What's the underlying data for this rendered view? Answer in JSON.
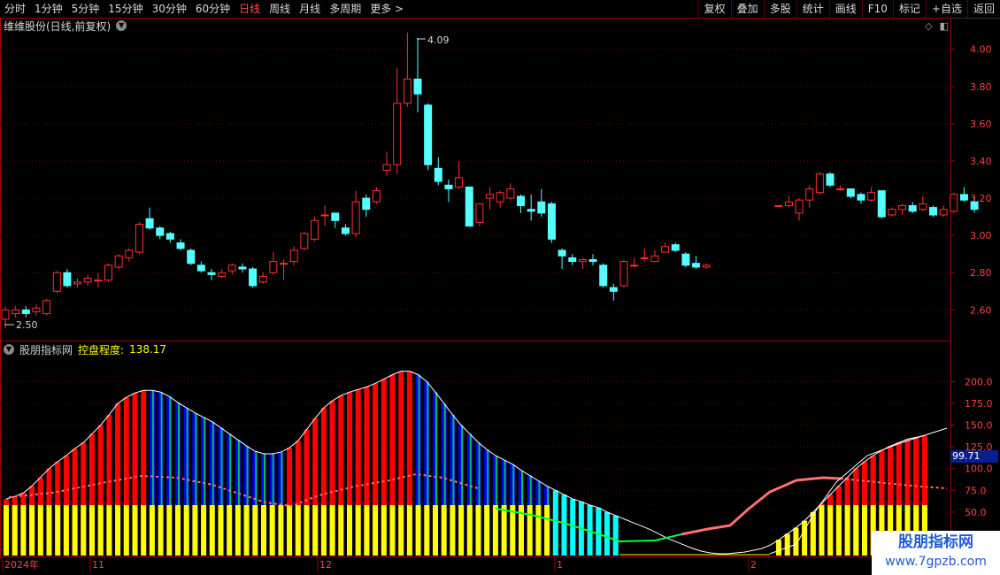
{
  "toolbar": {
    "periods": [
      "分时",
      "1分钟",
      "5分钟",
      "15分钟",
      "30分钟",
      "60分钟",
      "日线",
      "周线",
      "月线",
      "多周期",
      "更多 >"
    ],
    "active_period": "日线",
    "buttons": [
      "复权",
      "叠加",
      "多股",
      "统计",
      "画线",
      "F10",
      "标记",
      "+自选",
      "返回"
    ]
  },
  "chart_header": {
    "stock_title": "维维股份(日线,前复权)",
    "high_label": "4.09",
    "low_label": "2.50"
  },
  "indicator_header": {
    "name": "股朋指标网",
    "label": "控盘程度:",
    "value": "138.17"
  },
  "indicator_value_box": "99.71",
  "x_axis_labels": [
    "2024年",
    "11",
    "12",
    "1",
    "2"
  ],
  "watermark": {
    "line1": "股朋指标网",
    "line2": "www.7gpzb.com"
  },
  "colors": {
    "up": "#ff3030",
    "down": "#54ffff",
    "bar_red": "#ff0000",
    "bar_blue": "#0000ff",
    "bar_yellow": "#ffff00",
    "bar_cyan": "#00ffff",
    "grid": "#6a0000"
  },
  "chart_data": [
    {
      "type": "candlestick",
      "title": "维维股份(日线,前复权)",
      "y_ticks": [
        2.6,
        2.8,
        3.0,
        3.2,
        3.4,
        3.6,
        3.8,
        4.0
      ],
      "ylim": [
        2.44,
        4.16
      ],
      "candles": [
        [
          2.55,
          2.6,
          2.62,
          2.5
        ],
        [
          2.58,
          2.6,
          2.62,
          2.56
        ],
        [
          2.6,
          2.58,
          2.62,
          2.56
        ],
        [
          2.59,
          2.61,
          2.63,
          2.57
        ],
        [
          2.58,
          2.65,
          2.66,
          2.57
        ],
        [
          2.7,
          2.8,
          2.81,
          2.69
        ],
        [
          2.8,
          2.73,
          2.82,
          2.72
        ],
        [
          2.74,
          2.75,
          2.77,
          2.72
        ],
        [
          2.75,
          2.77,
          2.79,
          2.73
        ],
        [
          2.76,
          2.76,
          2.8,
          2.72
        ],
        [
          2.76,
          2.84,
          2.85,
          2.75
        ],
        [
          2.83,
          2.89,
          2.9,
          2.82
        ],
        [
          2.88,
          2.92,
          2.93,
          2.86
        ],
        [
          2.91,
          3.06,
          3.07,
          2.9
        ],
        [
          3.09,
          3.04,
          3.15,
          3.03
        ],
        [
          3.04,
          3.0,
          3.05,
          2.98
        ],
        [
          3.01,
          2.98,
          3.02,
          2.96
        ],
        [
          2.96,
          2.93,
          2.98,
          2.92
        ],
        [
          2.92,
          2.85,
          2.93,
          2.84
        ],
        [
          2.84,
          2.81,
          2.86,
          2.8
        ],
        [
          2.8,
          2.79,
          2.82,
          2.76
        ],
        [
          2.78,
          2.8,
          2.82,
          2.77
        ],
        [
          2.81,
          2.84,
          2.85,
          2.79
        ],
        [
          2.83,
          2.82,
          2.85,
          2.8
        ],
        [
          2.82,
          2.73,
          2.83,
          2.72
        ],
        [
          2.75,
          2.78,
          2.8,
          2.74
        ],
        [
          2.8,
          2.86,
          2.91,
          2.79
        ],
        [
          2.85,
          2.85,
          2.87,
          2.76
        ],
        [
          2.86,
          2.92,
          2.94,
          2.84
        ],
        [
          2.93,
          3.01,
          3.02,
          2.92
        ],
        [
          2.98,
          3.08,
          3.1,
          2.97
        ],
        [
          3.11,
          3.11,
          3.16,
          3.05
        ],
        [
          3.12,
          3.08,
          3.11,
          3.04
        ],
        [
          3.04,
          3.01,
          3.06,
          3.0
        ],
        [
          3.01,
          3.18,
          3.24,
          2.99
        ],
        [
          3.2,
          3.14,
          3.22,
          3.1
        ],
        [
          3.18,
          3.24,
          3.26,
          3.17
        ],
        [
          3.35,
          3.38,
          3.45,
          3.32
        ],
        [
          3.38,
          3.71,
          3.9,
          3.33
        ],
        [
          3.71,
          3.84,
          4.09,
          3.69
        ],
        [
          3.84,
          3.76,
          4.06,
          3.66
        ],
        [
          3.7,
          3.38,
          3.71,
          3.35
        ],
        [
          3.36,
          3.29,
          3.42,
          3.27
        ],
        [
          3.27,
          3.25,
          3.3,
          3.18
        ],
        [
          3.26,
          3.31,
          3.4,
          3.25
        ],
        [
          3.26,
          3.05,
          3.26,
          3.05
        ],
        [
          3.07,
          3.17,
          3.17,
          3.05
        ],
        [
          3.2,
          3.22,
          3.26,
          3.14
        ],
        [
          3.18,
          3.23,
          3.24,
          3.15
        ],
        [
          3.2,
          3.25,
          3.28,
          3.19
        ],
        [
          3.21,
          3.16,
          3.22,
          3.12
        ],
        [
          3.14,
          3.13,
          3.22,
          3.08
        ],
        [
          3.18,
          3.12,
          3.25,
          3.1
        ],
        [
          3.17,
          2.98,
          3.18,
          2.96
        ],
        [
          2.92,
          2.89,
          2.93,
          2.82
        ],
        [
          2.88,
          2.86,
          2.9,
          2.84
        ],
        [
          2.86,
          2.87,
          2.88,
          2.82
        ],
        [
          2.87,
          2.86,
          2.9,
          2.84
        ],
        [
          2.84,
          2.73,
          2.85,
          2.72
        ],
        [
          2.72,
          2.7,
          2.74,
          2.65
        ],
        [
          2.73,
          2.86,
          2.87,
          2.72
        ],
        [
          2.84,
          2.84,
          2.88,
          2.83
        ],
        [
          2.88,
          2.88,
          2.93,
          2.86
        ],
        [
          2.86,
          2.89,
          2.92,
          2.86
        ],
        [
          2.91,
          2.94,
          2.96,
          2.91
        ],
        [
          2.95,
          2.92,
          2.96,
          2.91
        ],
        [
          2.9,
          2.84,
          2.91,
          2.83
        ],
        [
          2.85,
          2.83,
          2.89,
          2.82
        ],
        [
          2.83,
          2.84,
          2.85,
          2.82
        ],
        null,
        null,
        null,
        null,
        null,
        null,
        [
          3.16,
          3.16,
          3.16,
          3.16
        ],
        [
          3.16,
          3.18,
          3.21,
          3.15
        ],
        [
          3.12,
          3.19,
          3.2,
          3.08
        ],
        [
          3.19,
          3.25,
          3.27,
          3.15
        ],
        [
          3.23,
          3.33,
          3.34,
          3.22
        ],
        [
          3.33,
          3.27,
          3.34,
          3.26
        ],
        [
          3.25,
          3.25,
          3.27,
          3.24
        ],
        [
          3.25,
          3.21,
          3.25,
          3.2
        ],
        [
          3.22,
          3.19,
          3.23,
          3.17
        ],
        [
          3.19,
          3.23,
          3.26,
          3.18
        ],
        [
          3.24,
          3.1,
          3.24,
          3.09
        ],
        [
          3.11,
          3.14,
          3.15,
          3.1
        ],
        [
          3.14,
          3.16,
          3.17,
          3.11
        ],
        [
          3.16,
          3.13,
          3.18,
          3.12
        ],
        [
          3.14,
          3.17,
          3.21,
          3.13
        ],
        [
          3.15,
          3.11,
          3.16,
          3.1
        ],
        [
          3.11,
          3.14,
          3.16,
          3.1
        ],
        [
          3.13,
          3.22,
          3.23,
          3.12
        ],
        [
          3.22,
          3.19,
          3.26,
          3.18
        ],
        [
          3.18,
          3.14,
          3.21,
          3.12
        ]
      ]
    },
    {
      "type": "bar",
      "title": "股朋指标网",
      "y_ticks": [
        50.0,
        75.0,
        100.0,
        125.0,
        150.0,
        175.0,
        200.0
      ],
      "ylim": [
        0,
        230
      ],
      "tall_values": [
        65,
        68,
        72,
        80,
        90,
        100,
        108,
        115,
        123,
        130,
        140,
        150,
        162,
        175,
        182,
        187,
        190,
        190,
        188,
        183,
        176,
        170,
        164,
        159,
        154,
        147,
        140,
        133,
        126,
        120,
        117,
        117,
        119,
        124,
        132,
        145,
        158,
        170,
        178,
        184,
        188,
        191,
        194,
        198,
        203,
        208,
        212,
        212,
        208,
        200,
        188,
        175,
        162,
        150,
        140,
        130,
        122,
        115,
        110,
        105,
        98,
        92,
        86,
        80,
        75,
        70,
        65,
        62,
        58,
        55,
        50,
        46,
        42,
        38,
        34,
        30,
        25,
        20,
        16,
        12,
        8,
        5,
        3,
        2,
        2,
        3,
        4,
        6,
        8,
        12,
        18,
        25,
        32,
        40,
        50,
        60,
        70,
        80,
        90,
        100,
        108,
        115,
        121,
        126,
        130,
        134,
        136,
        138
      ],
      "tall_kind": "r,r,r,r,r,r,r,r,r,r,r,r,r,r,r,r,r,b,b,b,b,b,b,b,b,b,b,b,b,b,b,b,b,r,r,r,r,r,r,r,r,r,r,r,r,r,r,r,b,b,b,b,b,b,b,b,b,b,b,b,b,b,b,b",
      "low_values": [
        58,
        58,
        58,
        58,
        58,
        58,
        58,
        58,
        58,
        58,
        58,
        58,
        58,
        58,
        58,
        58,
        58,
        58,
        58,
        58,
        58,
        58,
        58,
        58,
        58,
        58,
        58,
        58,
        58,
        58,
        58,
        58,
        58,
        58,
        58,
        58,
        58,
        58,
        58,
        58,
        58,
        58,
        58,
        58,
        58,
        58,
        58,
        58,
        58,
        58,
        58,
        58,
        58,
        58,
        58,
        58,
        58,
        58,
        58,
        58,
        58,
        58,
        58,
        58,
        58,
        58,
        45,
        38,
        30,
        25,
        20,
        15
      ],
      "line_pink": "rising then flat",
      "line_white_outline": "upper envelope"
    }
  ]
}
